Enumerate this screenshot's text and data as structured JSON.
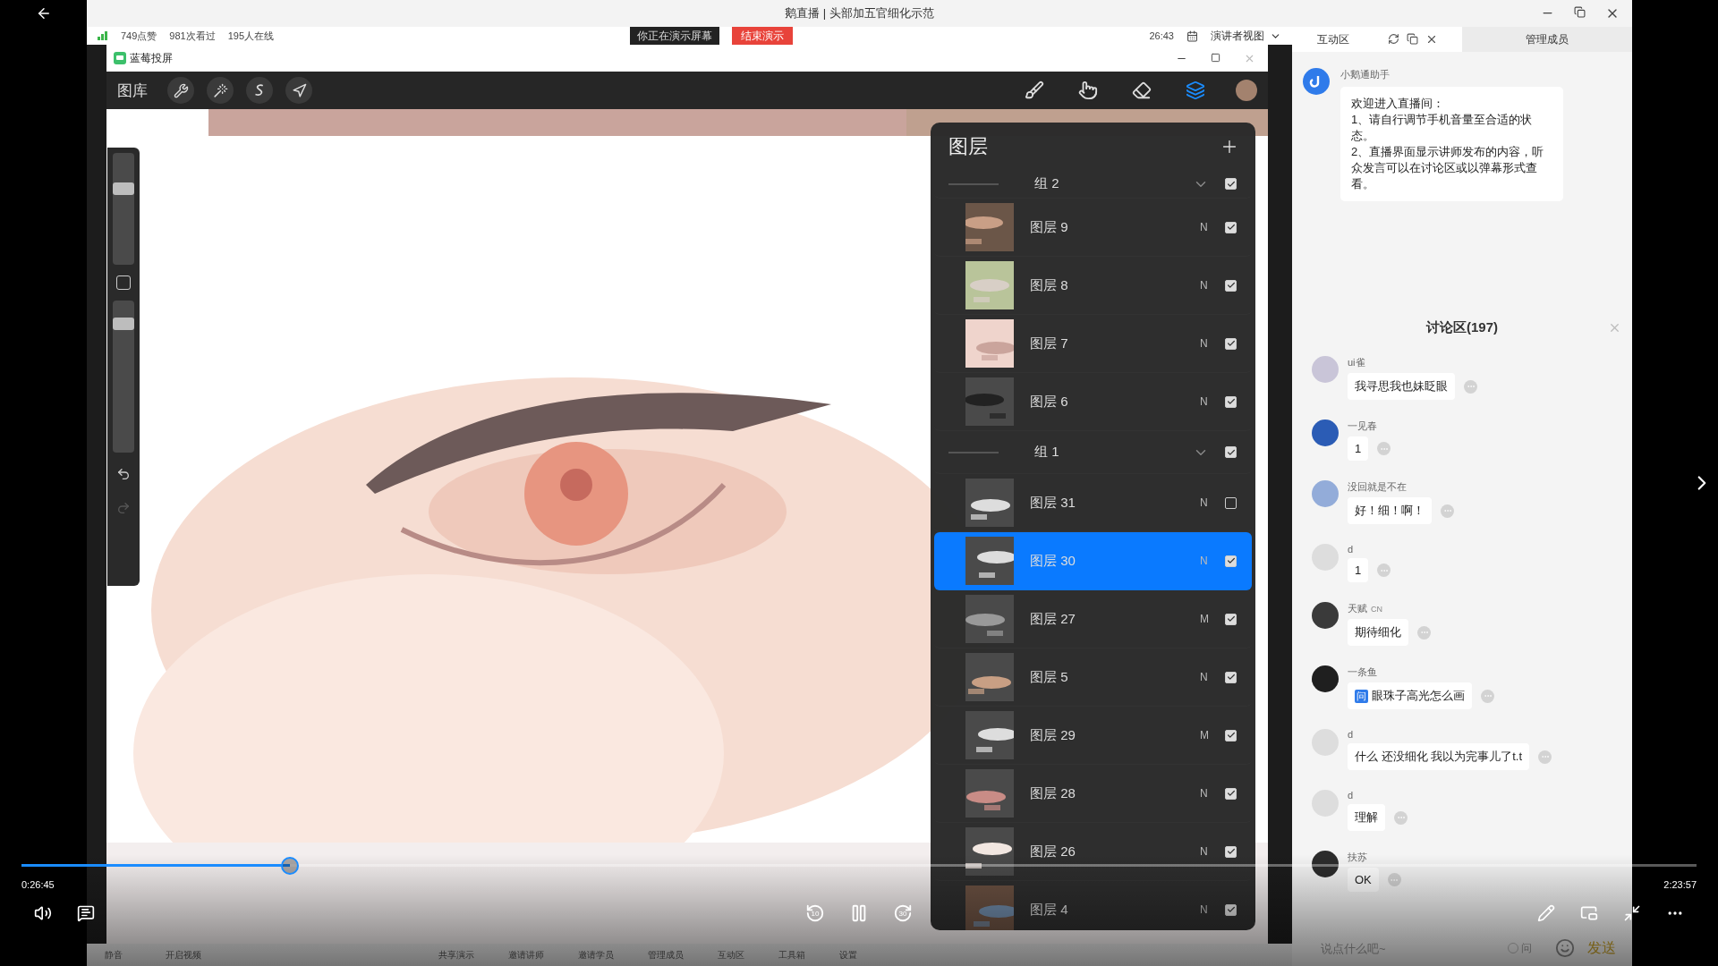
{
  "player": {
    "elapsed": "0:26:45",
    "duration": "2:23:57",
    "level": 0.16,
    "playing": true,
    "rewind": "10",
    "forward": "30"
  },
  "window": {
    "title": "鹅直播 | 头部加五官细化示范"
  },
  "stats": {
    "likes": "749点赞",
    "views": "981次看过",
    "online": "195人在线",
    "presenting": "你正在演示屏幕",
    "end_button": "结束演示",
    "timer": "26:43",
    "view_mode": "演讲者视图"
  },
  "mirror_window": {
    "title": "蓝莓投屏"
  },
  "app": {
    "gallery": "图库",
    "tools": [
      {
        "kind": "wrench"
      },
      {
        "kind": "wand"
      },
      {
        "kind": "selection"
      },
      {
        "kind": "transform"
      }
    ],
    "right_tools": [
      {
        "kind": "brush",
        "selected": false
      },
      {
        "kind": "smudge",
        "selected": false
      },
      {
        "kind": "eraser",
        "selected": false
      },
      {
        "kind": "layers",
        "selected": true
      }
    ],
    "sidebar": {
      "sliders": [
        {
          "kind": "size",
          "level": 0.7
        },
        {
          "kind": "opacity",
          "level": 0.88
        }
      ]
    }
  },
  "layers_panel": {
    "title": "图层",
    "items": [
      {
        "kind": "group",
        "name": "组 2",
        "expanded": true,
        "visible": true,
        "selected": false
      },
      {
        "kind": "layer",
        "name": "图层 9",
        "blend": "N",
        "visible": true,
        "selected": false
      },
      {
        "kind": "layer",
        "name": "图层 8",
        "blend": "N",
        "visible": true,
        "selected": false
      },
      {
        "kind": "layer",
        "name": "图层 7",
        "blend": "N",
        "visible": true,
        "selected": false
      },
      {
        "kind": "layer",
        "name": "图层 6",
        "blend": "N",
        "visible": true,
        "selected": false
      },
      {
        "kind": "group",
        "name": "组 1",
        "expanded": true,
        "visible": true,
        "selected": false
      },
      {
        "kind": "layer",
        "name": "图层 31",
        "blend": "N",
        "visible": false,
        "selected": false
      },
      {
        "kind": "layer",
        "name": "图层 30",
        "blend": "N",
        "visible": true,
        "selected": true
      },
      {
        "kind": "layer",
        "name": "图层 27",
        "blend": "M",
        "visible": true,
        "selected": false
      },
      {
        "kind": "layer",
        "name": "图层 5",
        "blend": "N",
        "visible": true,
        "selected": false
      },
      {
        "kind": "layer",
        "name": "图层 29",
        "blend": "M",
        "visible": true,
        "selected": false
      },
      {
        "kind": "layer",
        "name": "图层 28",
        "blend": "N",
        "visible": true,
        "selected": false
      },
      {
        "kind": "layer",
        "name": "图层 26",
        "blend": "N",
        "visible": true,
        "selected": false
      },
      {
        "kind": "layer",
        "name": "图层 4",
        "blend": "N",
        "visible": true,
        "selected": false
      }
    ]
  },
  "chat": {
    "tabs": [
      {
        "label": "互动区",
        "selected": true
      },
      {
        "label": "管理成员",
        "selected": false
      }
    ],
    "bot": {
      "name": "小鹅通助手",
      "lines": [
        "欢迎进入直播间：",
        "1、请自行调节手机音量至合适的状态。",
        "2、直播界面显示讲师发布的内容，听众发言可以在讨论区或以弹幕形式查看。"
      ]
    },
    "discussion_title": "讨论区(197)",
    "messages": [
      {
        "name": "ui雀",
        "text": "我寻思我也妹眨眼",
        "color": "#c9c5d8"
      },
      {
        "name": "一见春",
        "text": "1",
        "color": "#2b5cb5"
      },
      {
        "name": "没回就是不在",
        "text": "好！细！啊！",
        "color": "#93acd9"
      },
      {
        "name": "d",
        "text": "1",
        "color": "#dddddd"
      },
      {
        "name": "天赋",
        "badge": "CN",
        "text": "期待细化",
        "color": "#3a3a3a"
      },
      {
        "name": "一条鱼",
        "question": "问",
        "text": "眼珠子高光怎么画",
        "color": "#1f1f1f"
      },
      {
        "name": "d",
        "text": "什么 还没细化 我以为完事儿了t.t",
        "color": "#dddddd"
      },
      {
        "name": "d",
        "text": "理解",
        "color": "#dddddd"
      },
      {
        "name": "扶苏",
        "text": "OK",
        "color": "#2c2c2c"
      }
    ],
    "input": {
      "placeholder": "说点什么吧~",
      "ask_label": "问",
      "ask_checked": false,
      "send": "发送"
    }
  },
  "bottom_toolbar": [
    "静音",
    "开启视频",
    "共享演示",
    "邀请讲师",
    "邀请学员",
    "管理成员",
    "互动区",
    "工具箱",
    "设置"
  ]
}
